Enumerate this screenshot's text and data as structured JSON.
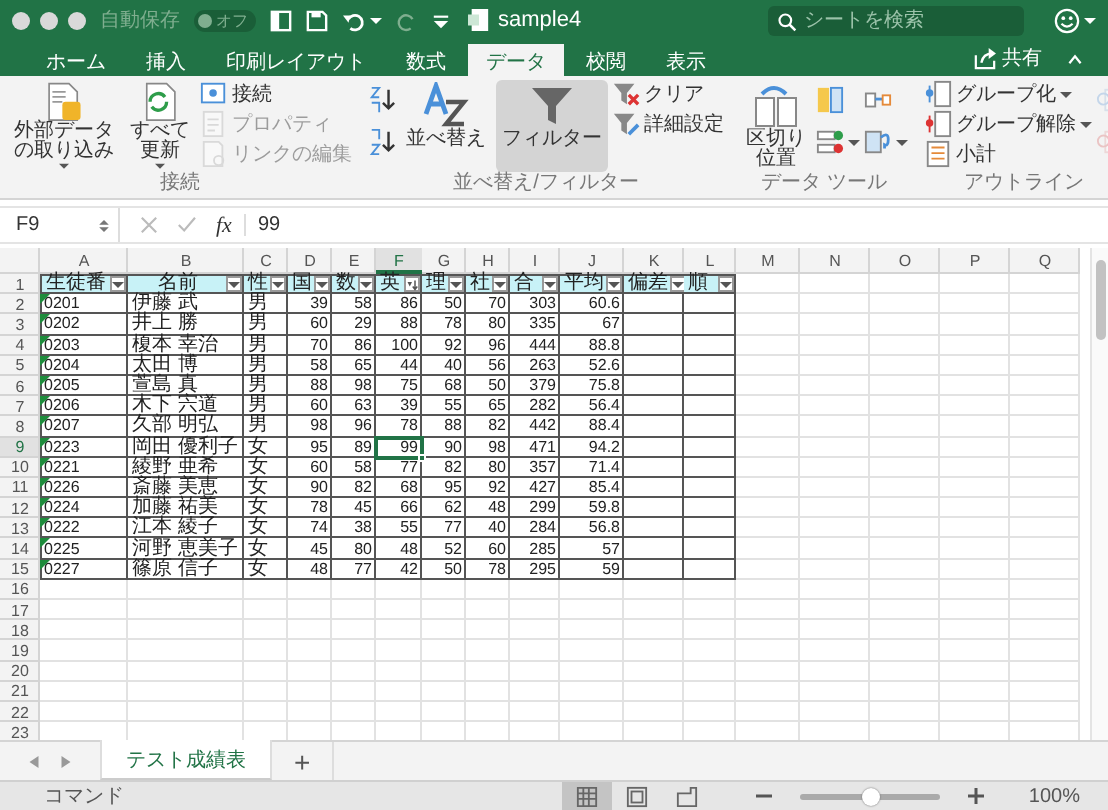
{
  "window": {
    "autosave": {
      "label": "自動保存",
      "state_label": "オフ",
      "on": false
    },
    "title": "sample4",
    "search": {
      "placeholder": "シートを検索"
    }
  },
  "ribbon_tabs": [
    {
      "label": "ホーム",
      "selected": false
    },
    {
      "label": "挿入",
      "selected": false
    },
    {
      "label": "印刷レイアウト",
      "selected": false
    },
    {
      "label": "数式",
      "selected": false
    },
    {
      "label": "データ",
      "selected": true
    },
    {
      "label": "校閲",
      "selected": false
    },
    {
      "label": "表示",
      "selected": false
    }
  ],
  "share_button": "共有",
  "ribbon_groups": [
    {
      "label": "接続",
      "items": [
        {
          "kind": "wrapped",
          "label": "外部データの取り込み",
          "menu": true,
          "pressed": false
        },
        {
          "kind": "wrapped",
          "label": "すべて更新",
          "menu": true,
          "pressed": false
        },
        {
          "kind": "stack",
          "buttons": [
            {
              "label": "接続",
              "disabled": false,
              "menu": false
            },
            {
              "label": "プロパティ",
              "disabled": true,
              "menu": false
            },
            {
              "label": "リンクの編集",
              "disabled": true,
              "menu": false
            }
          ]
        }
      ]
    },
    {
      "label": "並べ替え/フィルター",
      "items": [
        {
          "kind": "icons",
          "buttons": [
            {
              "disabled": false,
              "menu": false
            },
            {
              "disabled": false,
              "menu": false
            }
          ]
        },
        {
          "kind": "large",
          "label": "並べ替え",
          "menu": false,
          "pressed": false
        },
        {
          "kind": "large",
          "label": "フィルター",
          "menu": false,
          "pressed": true
        },
        {
          "kind": "stack",
          "buttons": [
            {
              "label": "クリア",
              "disabled": false,
              "menu": false
            },
            {
              "label": "詳細設定",
              "disabled": false,
              "menu": false
            }
          ]
        }
      ]
    },
    {
      "label": "データ ツール",
      "items": [
        {
          "kind": "wrapped",
          "label": "区切り位置",
          "menu": false,
          "pressed": false
        },
        {
          "kind": "icons",
          "buttons": [
            {
              "disabled": false,
              "menu": false
            },
            {
              "disabled": false,
              "menu": true
            }
          ]
        },
        {
          "kind": "icons",
          "buttons": [
            {
              "disabled": false,
              "menu": false
            },
            {
              "disabled": false,
              "menu": true
            }
          ]
        }
      ]
    },
    {
      "label": "アウトライン",
      "items": [
        {
          "kind": "stack",
          "buttons": [
            {
              "label": "グループ化",
              "disabled": false,
              "menu": true
            },
            {
              "label": "グループ解除",
              "disabled": false,
              "menu": true
            },
            {
              "label": "小計",
              "disabled": false,
              "menu": false
            }
          ]
        },
        {
          "kind": "icons",
          "buttons": [
            {
              "disabled": true,
              "menu": false
            },
            {
              "disabled": true,
              "menu": false
            }
          ]
        }
      ]
    }
  ],
  "formula_bar": {
    "name_box": "F9",
    "function_label": "fx",
    "formula": "99"
  },
  "sheet": {
    "columns": [
      {
        "letter": "A",
        "selected": false
      },
      {
        "letter": "B",
        "selected": false
      },
      {
        "letter": "C",
        "selected": false
      },
      {
        "letter": "D",
        "selected": false
      },
      {
        "letter": "E",
        "selected": false
      },
      {
        "letter": "F",
        "selected": true
      },
      {
        "letter": "G",
        "selected": false
      },
      {
        "letter": "H",
        "selected": false
      },
      {
        "letter": "I",
        "selected": false
      },
      {
        "letter": "J",
        "selected": false
      },
      {
        "letter": "K",
        "selected": false
      },
      {
        "letter": "L",
        "selected": false
      },
      {
        "letter": "M",
        "selected": false
      },
      {
        "letter": "N",
        "selected": false
      },
      {
        "letter": "O",
        "selected": false
      },
      {
        "letter": "P",
        "selected": false
      },
      {
        "letter": "Q",
        "selected": false
      }
    ],
    "rows": [
      {
        "number": "1",
        "kind": "header",
        "selected": false,
        "flagged": false,
        "cells": [
          {
            "text": "生徒番",
            "sorted": false
          },
          {
            "text": "名前",
            "sorted": false
          },
          {
            "text": "性",
            "sorted": false
          },
          {
            "text": "国",
            "sorted": false
          },
          {
            "text": "数",
            "sorted": false
          },
          {
            "text": "英",
            "sorted": true
          },
          {
            "text": "理",
            "sorted": false
          },
          {
            "text": "社",
            "sorted": false
          },
          {
            "text": "合",
            "sorted": false
          },
          {
            "text": "平均",
            "sorted": false
          },
          {
            "text": "偏差",
            "sorted": false
          },
          {
            "text": "順",
            "sorted": false
          }
        ]
      },
      {
        "number": "2",
        "kind": "record",
        "selected": false,
        "flagged": true,
        "cells": [
          "0201",
          "伊藤 武",
          "男",
          "39",
          "58",
          "86",
          "50",
          "70",
          "303",
          "60.6"
        ]
      },
      {
        "number": "3",
        "kind": "record",
        "selected": false,
        "flagged": true,
        "cells": [
          "0202",
          "井上 勝",
          "男",
          "60",
          "29",
          "88",
          "78",
          "80",
          "335",
          "67"
        ]
      },
      {
        "number": "4",
        "kind": "record",
        "selected": false,
        "flagged": true,
        "cells": [
          "0203",
          "榎本 幸治",
          "男",
          "70",
          "86",
          "100",
          "92",
          "96",
          "444",
          "88.8"
        ]
      },
      {
        "number": "5",
        "kind": "record",
        "selected": false,
        "flagged": true,
        "cells": [
          "0204",
          "太田 博",
          "男",
          "58",
          "65",
          "44",
          "40",
          "56",
          "263",
          "52.6"
        ]
      },
      {
        "number": "6",
        "kind": "record",
        "selected": false,
        "flagged": true,
        "cells": [
          "0205",
          "萱島 真",
          "男",
          "88",
          "98",
          "75",
          "68",
          "50",
          "379",
          "75.8"
        ]
      },
      {
        "number": "7",
        "kind": "record",
        "selected": false,
        "flagged": true,
        "cells": [
          "0206",
          "木下 宍道",
          "男",
          "60",
          "63",
          "39",
          "55",
          "65",
          "282",
          "56.4"
        ]
      },
      {
        "number": "8",
        "kind": "record",
        "selected": false,
        "flagged": true,
        "cells": [
          "0207",
          "久部 明弘",
          "男",
          "98",
          "96",
          "78",
          "88",
          "82",
          "442",
          "88.4"
        ]
      },
      {
        "number": "9",
        "kind": "record",
        "selected": true,
        "flagged": true,
        "cells": [
          "0223",
          "岡田 優利子",
          "女",
          "95",
          "89",
          "99",
          "90",
          "98",
          "471",
          "94.2"
        ]
      },
      {
        "number": "10",
        "kind": "record",
        "selected": false,
        "flagged": true,
        "cells": [
          "0221",
          "綾野 亜希",
          "女",
          "60",
          "58",
          "77",
          "82",
          "80",
          "357",
          "71.4"
        ]
      },
      {
        "number": "11",
        "kind": "record",
        "selected": false,
        "flagged": true,
        "cells": [
          "0226",
          "斎藤 美恵",
          "女",
          "90",
          "82",
          "68",
          "95",
          "92",
          "427",
          "85.4"
        ]
      },
      {
        "number": "12",
        "kind": "record",
        "selected": false,
        "flagged": true,
        "cells": [
          "0224",
          "加藤 祐美",
          "女",
          "78",
          "45",
          "66",
          "62",
          "48",
          "299",
          "59.8"
        ]
      },
      {
        "number": "13",
        "kind": "record",
        "selected": false,
        "flagged": true,
        "cells": [
          "0222",
          "江本 綾子",
          "女",
          "74",
          "38",
          "55",
          "77",
          "40",
          "284",
          "56.8"
        ]
      },
      {
        "number": "14",
        "kind": "record",
        "selected": false,
        "flagged": true,
        "cells": [
          "0225",
          "河野 恵美子",
          "女",
          "45",
          "80",
          "48",
          "52",
          "60",
          "285",
          "57"
        ]
      },
      {
        "number": "15",
        "kind": "record",
        "selected": false,
        "flagged": true,
        "cells": [
          "0227",
          "篠原 信子",
          "女",
          "48",
          "77",
          "42",
          "50",
          "78",
          "295",
          "59"
        ]
      },
      {
        "number": "16",
        "kind": "blank",
        "selected": false,
        "flagged": false
      },
      {
        "number": "17",
        "kind": "blank",
        "selected": false,
        "flagged": false
      },
      {
        "number": "18",
        "kind": "blank",
        "selected": false,
        "flagged": false
      },
      {
        "number": "19",
        "kind": "blank",
        "selected": false,
        "flagged": false
      },
      {
        "number": "20",
        "kind": "blank",
        "selected": false,
        "flagged": false
      },
      {
        "number": "21",
        "kind": "blank",
        "selected": false,
        "flagged": false
      },
      {
        "number": "22",
        "kind": "blank",
        "selected": false,
        "flagged": false
      },
      {
        "number": "23",
        "kind": "blank",
        "selected": false,
        "flagged": false
      }
    ]
  },
  "sheet_tabs": [
    {
      "label": "テスト成績表",
      "selected": true
    }
  ],
  "add_sheet": "+",
  "status_bar": {
    "mode": "コマンド",
    "views": [
      {
        "selected": true
      },
      {
        "selected": false
      },
      {
        "selected": false
      }
    ],
    "zoom": {
      "level": 0.5,
      "reading": "100%"
    }
  }
}
